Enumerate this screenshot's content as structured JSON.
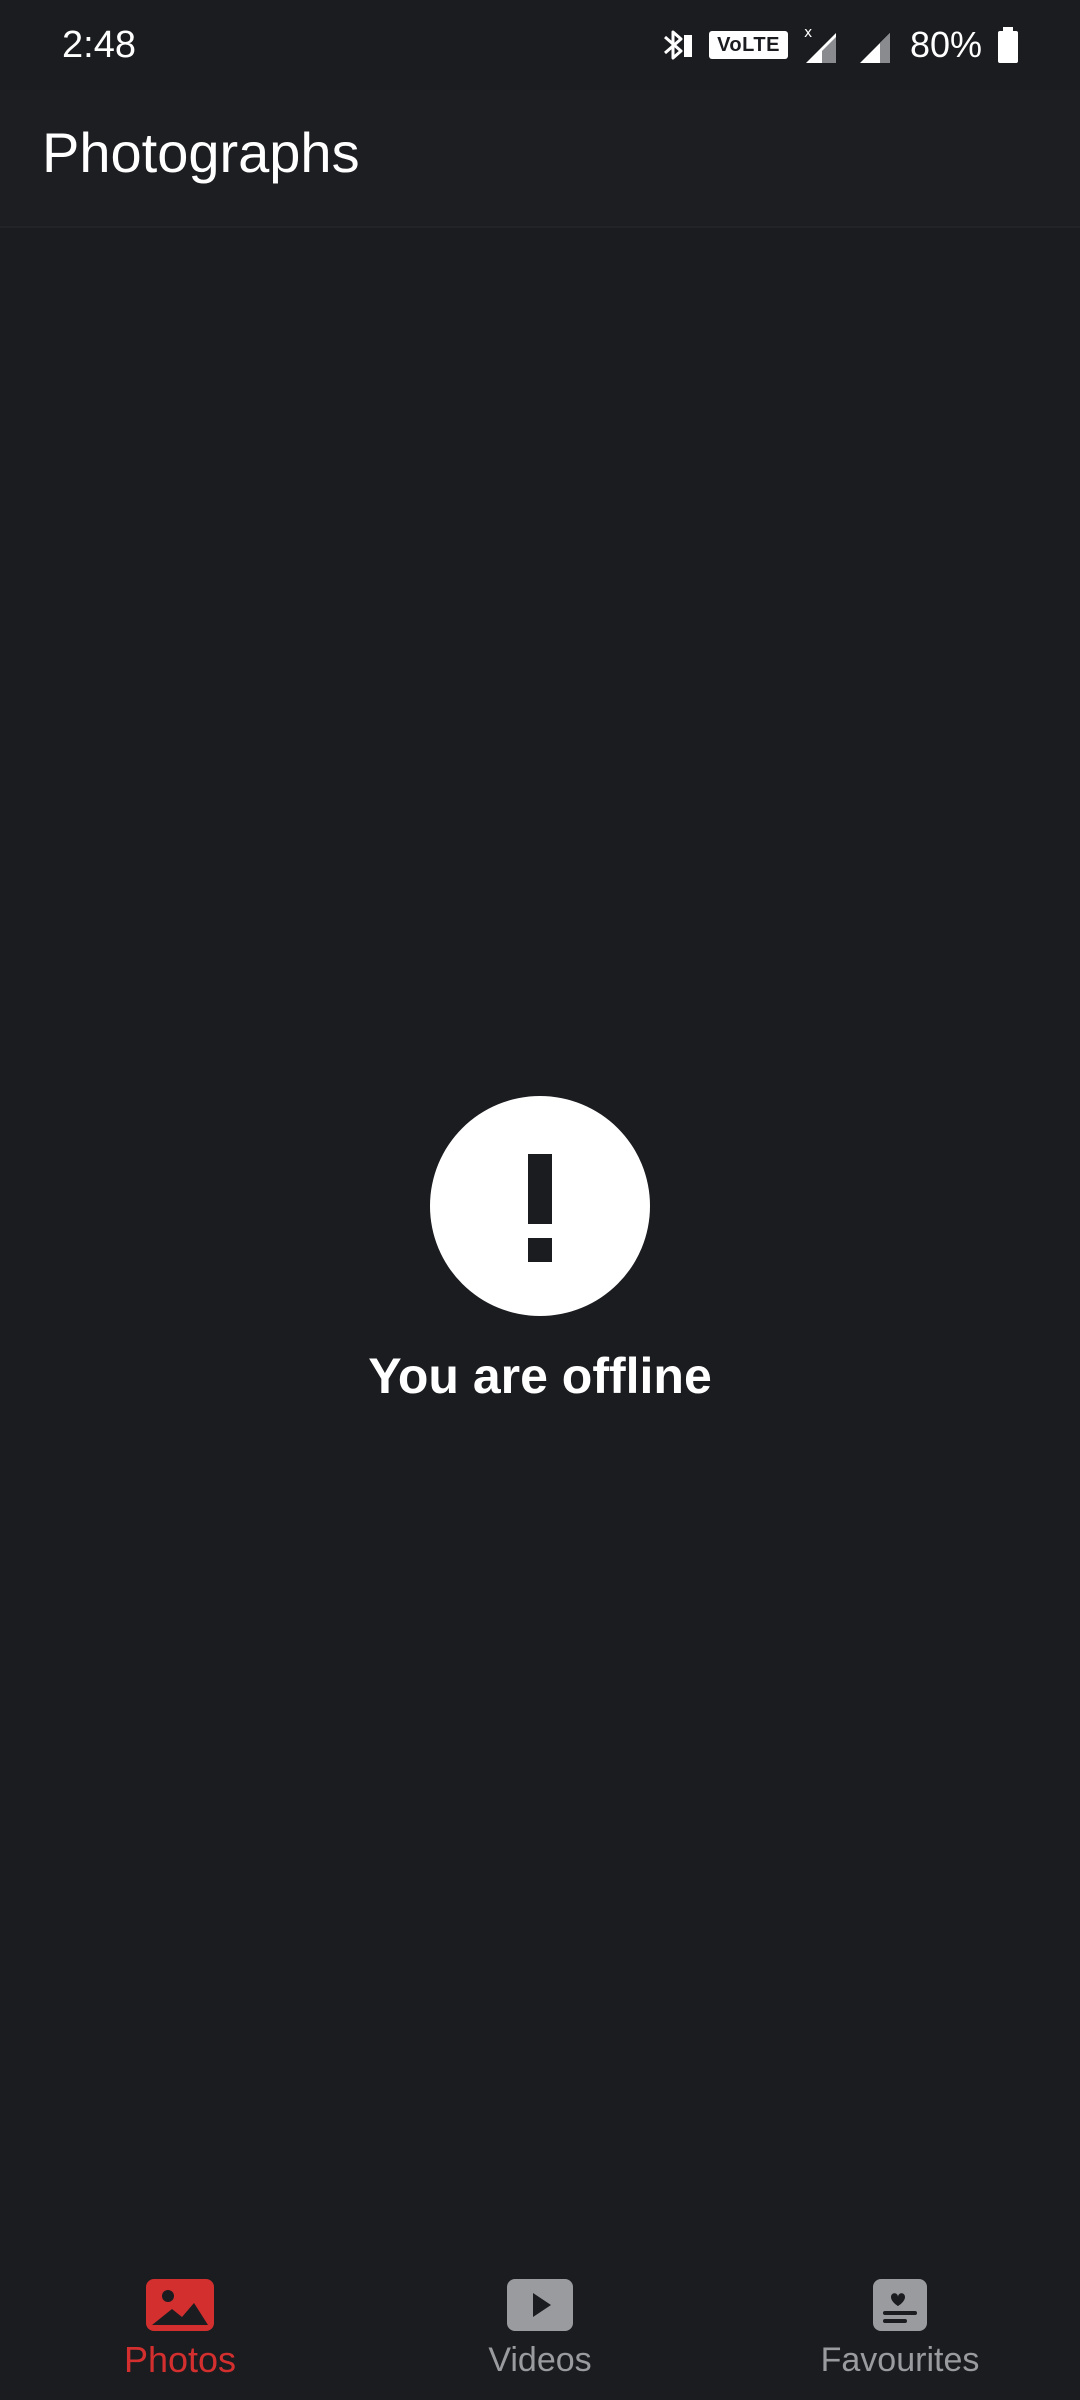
{
  "status_bar": {
    "time": "2:48",
    "volte": "VoLTE",
    "battery": "80%",
    "icons": [
      "bluetooth-icon",
      "volte-icon",
      "signal-x-icon",
      "signal-icon",
      "battery-icon"
    ]
  },
  "app_bar": {
    "title": "Photographs"
  },
  "offline": {
    "icon": "exclamation-circle-icon",
    "message": "You are offline"
  },
  "bottom_nav": {
    "items": [
      {
        "label": "Photos",
        "icon": "photo-icon",
        "active": true
      },
      {
        "label": "Videos",
        "icon": "video-play-icon",
        "active": false
      },
      {
        "label": "Favourites",
        "icon": "favourites-icon",
        "active": false
      }
    ]
  },
  "colors": {
    "background": "#1b1c20",
    "accent": "#d32f2f",
    "inactive": "#9a9b9f",
    "text": "#ffffff"
  }
}
